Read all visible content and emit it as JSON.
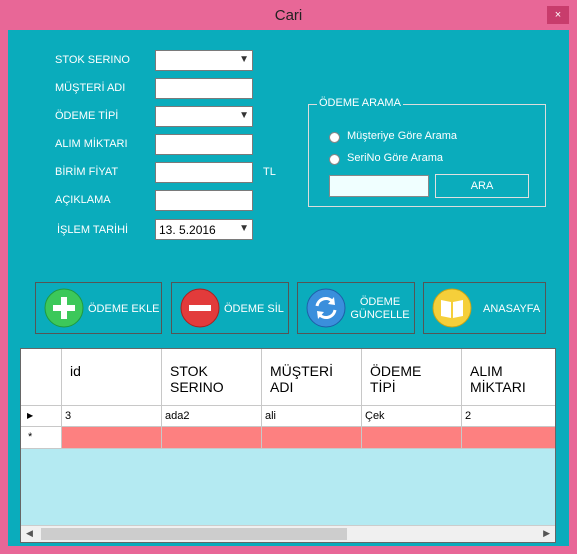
{
  "window": {
    "title": "Cari",
    "close_label": "×"
  },
  "form": {
    "stok_serino_label": "STOK SERINO",
    "musteri_adi_label": "MÜŞTERİ ADI",
    "odeme_tipi_label": "ÖDEME TİPİ",
    "alim_miktari_label": "ALIM MİKTARI",
    "birim_fiyat_label": "BİRİM FİYAT",
    "aciklama_label": "AÇIKLAMA",
    "islem_tarihi_label": "İŞLEM TARİHİ",
    "islem_tarihi_value": "13.  5.2016",
    "tl_label": "TL"
  },
  "search_group": {
    "legend": "ÖDEME ARAMA",
    "radio1_label": "Müşteriye Göre Arama",
    "radio2_label": "SeriNo Göre Arama",
    "search_value": "",
    "button_label": "ARA"
  },
  "buttons": {
    "odeme_ekle": "ÖDEME EKLE",
    "odeme_sil": "ÖDEME SİL",
    "odeme_guncelle_1": "ÖDEME",
    "odeme_guncelle_2": "GÜNCELLE",
    "anasayfa": "ANASAYFA"
  },
  "grid": {
    "headers": [
      {
        "line1": "id",
        "line2": ""
      },
      {
        "line1": "STOK",
        "line2": "SERINO"
      },
      {
        "line1": "MÜŞTERİ",
        "line2": "ADI"
      },
      {
        "line1": "ÖDEME",
        "line2": "TİPİ"
      },
      {
        "line1": "ALIM",
        "line2": "MİKTARI"
      }
    ],
    "rows": [
      [
        "3",
        "ada2",
        "ali",
        "Çek",
        "2"
      ]
    ],
    "current_row_marker": "▶",
    "new_row_marker": "*"
  },
  "icons": {
    "add": "plus-icon",
    "remove": "minus-icon",
    "refresh": "refresh-icon",
    "home": "book-icon"
  },
  "colors": {
    "frame": "#e86797",
    "client": "#0aacbc",
    "new_row": "#fd8080",
    "grid_empty": "#b4eaf2"
  }
}
